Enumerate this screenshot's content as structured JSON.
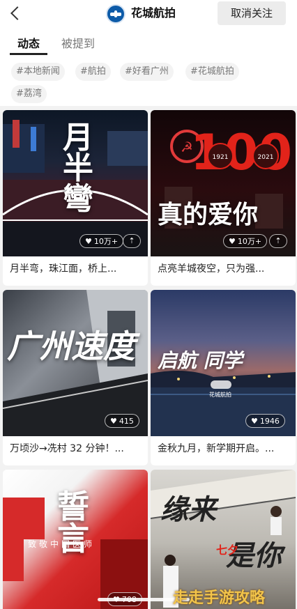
{
  "header": {
    "title": "花城航拍",
    "unfollow_label": "取消关注"
  },
  "tabs": [
    {
      "label": "动态",
      "active": true
    },
    {
      "label": "被提到",
      "active": false
    }
  ],
  "hashtags": [
    "#本地新闻",
    "#航拍",
    "#好看广州",
    "#花城航拍",
    "#荔湾"
  ],
  "cards": [
    {
      "caption": "月半弯，珠江面，桥上...",
      "likes": "10万+",
      "overlay_text": "月半彎"
    },
    {
      "caption": "点亮羊城夜空，只为强...",
      "likes": "10万+",
      "overlay_text": "真的爱你",
      "badge_years": [
        "1921",
        "2021"
      ],
      "badge_number": "100"
    },
    {
      "caption": "万顷沙→冼村 32 分钟！...",
      "likes": "415",
      "overlay_text": "广州速度"
    },
    {
      "caption": "金秋九月，新学期开启。...",
      "likes": "1946",
      "overlay_text": "启航 同学",
      "logo_text": "花城航拍"
    },
    {
      "caption": "",
      "likes": "708",
      "overlay_text": "誓言",
      "subtitle": "致敬中国医师"
    },
    {
      "caption": "",
      "likes": "",
      "overlay_text": "缘来是你",
      "accent": "七夕"
    }
  ],
  "watermark": "走走手游攻略",
  "colors": {
    "header_bg": "#ffffff",
    "page_bg": "#f2f2f2",
    "accent_red": "#e2231a",
    "watermark": "#f2c44a"
  }
}
